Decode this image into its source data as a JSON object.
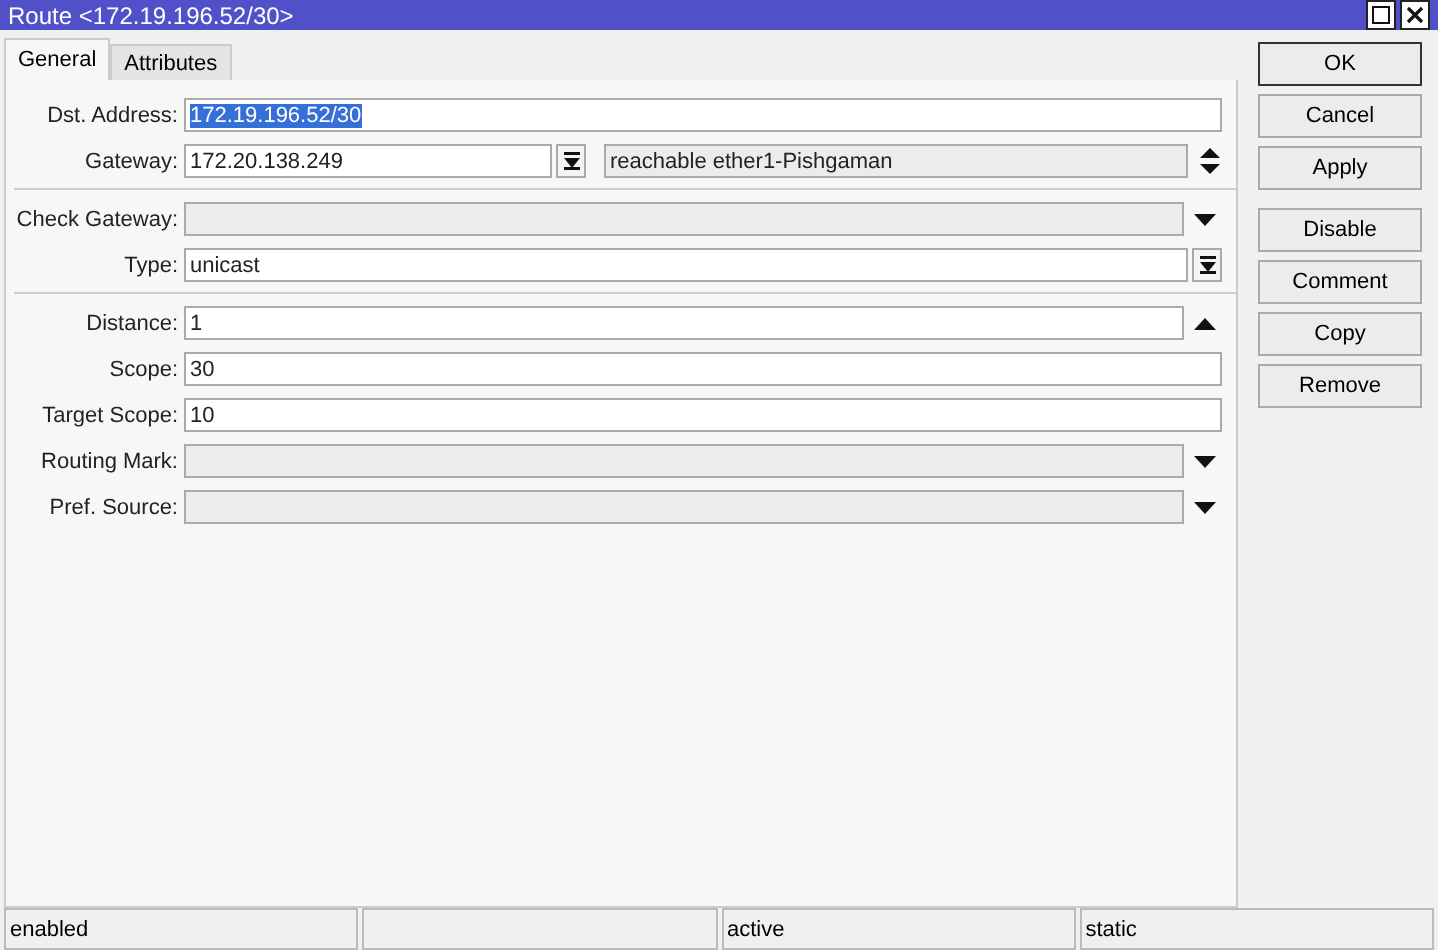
{
  "window": {
    "title": "Route <172.19.196.52/30>"
  },
  "tabs": [
    {
      "label": "General",
      "selected": true
    },
    {
      "label": "Attributes",
      "selected": false
    }
  ],
  "groups": [
    [
      {
        "label": "Dst. Address:",
        "kind": "plain",
        "value": "172.19.196.52/30",
        "highlighted": true,
        "disabled": false
      },
      {
        "label": "Gateway:",
        "kind": "gateway",
        "value": "172.20.138.249",
        "status": "reachable ether1-Pishgaman",
        "disabled": false
      }
    ],
    [
      {
        "label": "Check Gateway:",
        "kind": "down",
        "disabled": true
      },
      {
        "label": "Type:",
        "kind": "menu",
        "value": "unicast",
        "disabled": false
      }
    ],
    [
      {
        "label": "Distance:",
        "kind": "up",
        "value": "1",
        "disabled": false
      },
      {
        "label": "Scope:",
        "kind": "plain",
        "value": "30",
        "disabled": false
      },
      {
        "label": "Target Scope:",
        "kind": "plain",
        "value": "10",
        "disabled": false
      },
      {
        "label": "Routing Mark:",
        "kind": "down",
        "disabled": true
      },
      {
        "label": "Pref. Source:",
        "kind": "down",
        "disabled": true
      }
    ]
  ],
  "buttons": [
    [
      "OK",
      "Cancel",
      "Apply"
    ],
    [
      "Disable",
      "Comment",
      "Copy",
      "Remove"
    ]
  ],
  "status_bar": {
    "column_1": "enabled",
    "column_3": "active",
    "column_4": "static"
  }
}
